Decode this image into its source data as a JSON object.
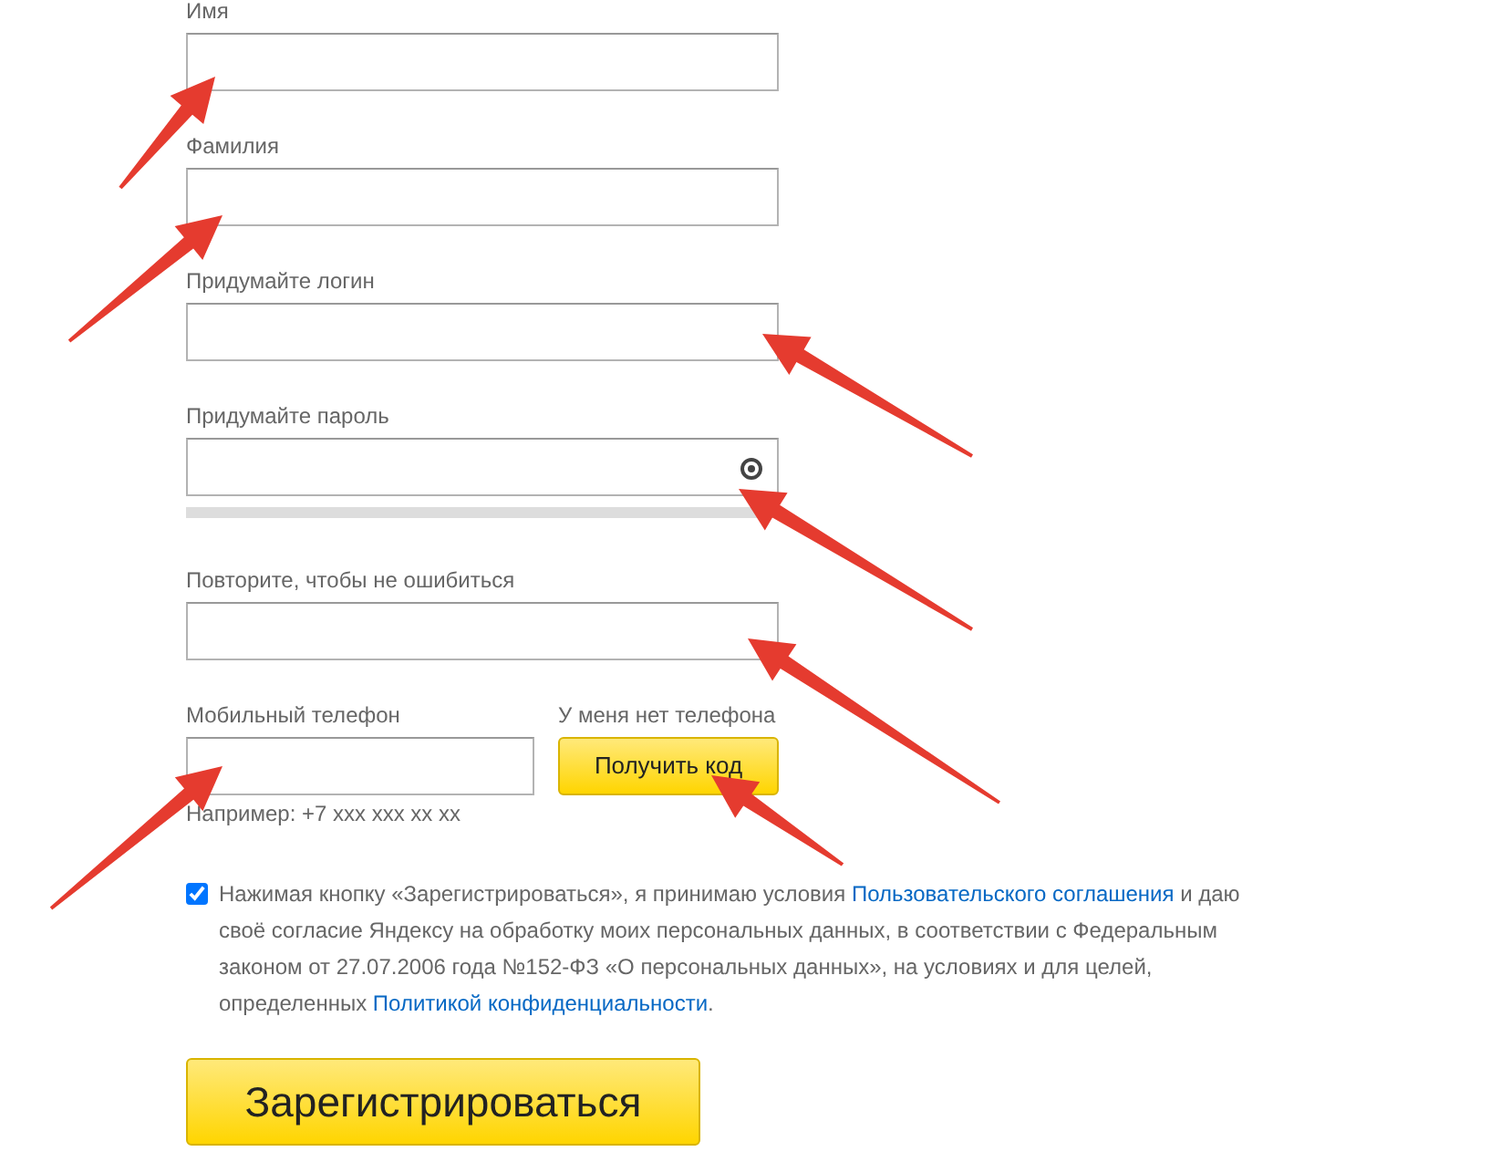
{
  "fields": [
    {
      "label": "Имя",
      "kind": "text"
    },
    {
      "label": "Фамилия",
      "kind": "text"
    },
    {
      "label": "Придумайте логин",
      "kind": "text"
    },
    {
      "label": "Придумайте пароль",
      "kind": "password",
      "strength": {
        "level": 0
      }
    },
    {
      "label": "Повторите, чтобы не ошибиться",
      "kind": "text"
    }
  ],
  "phone": {
    "label": "Мобильный телефон",
    "no_phone_link": "У меня нет телефона",
    "button": "Получить код",
    "hint": "Например: +7 xxx xxx xx xx"
  },
  "agreement": {
    "checked": true,
    "parts": [
      {
        "text": "Нажимая кнопку «Зарегистрироваться», я принимаю условия ",
        "kind": "text"
      },
      {
        "text": "Пользовательского соглашения",
        "kind": "link"
      },
      {
        "text": " и даю своё согласие Яндексу на обработку моих персональных данных, в соответствии с Федеральным законом от 27.07.2006 года №152-ФЗ «О персональных данных», на условиях и для целей, определенных ",
        "kind": "text"
      },
      {
        "text": "Политикой конфиденциальности",
        "kind": "link"
      },
      {
        "text": ".",
        "kind": "text"
      }
    ]
  },
  "submit": "Зарегистрироваться"
}
